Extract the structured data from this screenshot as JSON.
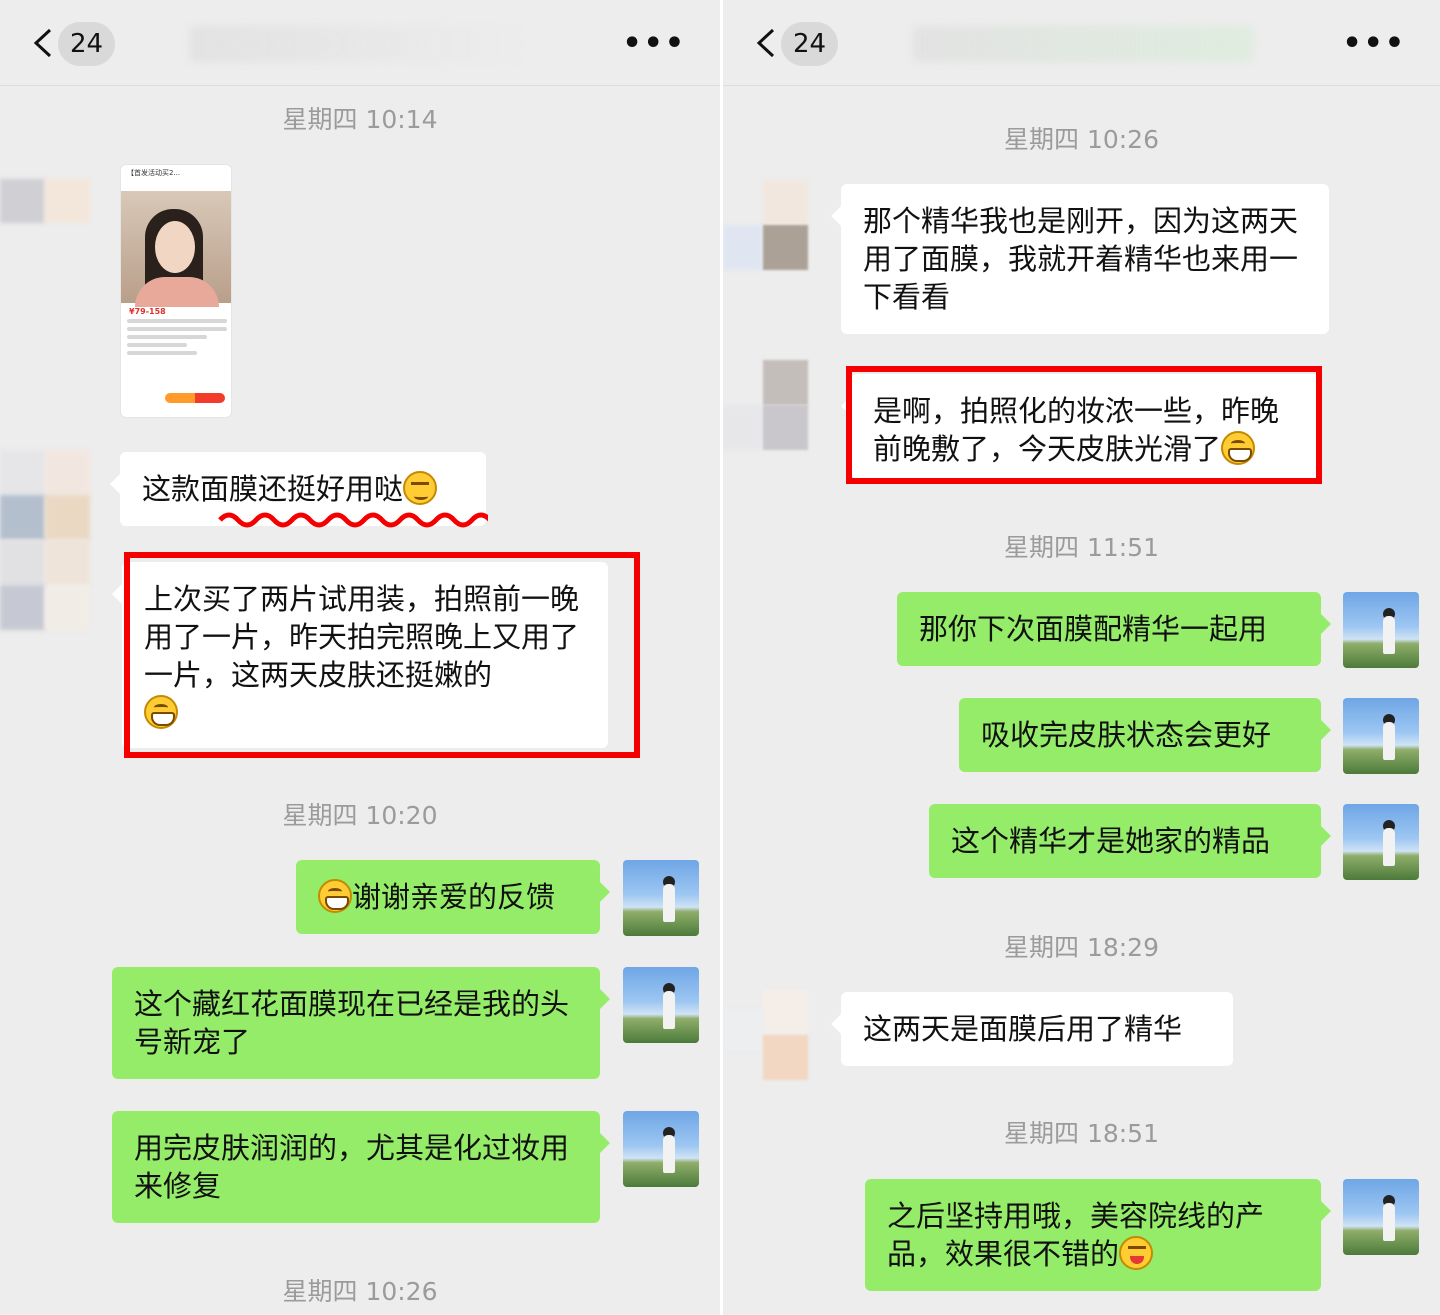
{
  "left": {
    "header": {
      "unread_badge": "24",
      "more": "•••"
    },
    "timestamps": [
      "星期四 10:14",
      "星期四 10:20",
      "星期四 10:26"
    ],
    "thumbnail": {
      "title": "【首发活动买2...",
      "price": "¥79-158"
    },
    "incoming": [
      "这款面膜还挺好用哒",
      "上次买了两片试用装，拍照前一晚用了一片，昨天拍完照晚上又用了一片，这两天皮肤还挺嫩的"
    ],
    "outgoing": [
      "谢谢亲爱的反馈",
      "这个藏红花面膜现在已经是我的头号新宠了",
      "用完皮肤润润的，尤其是化过妆用来修复"
    ]
  },
  "right": {
    "header": {
      "unread_badge": "24",
      "more": "•••"
    },
    "timestamps": [
      "星期四 10:26",
      "星期四 11:51",
      "星期四 18:29",
      "星期四 18:51"
    ],
    "incoming": [
      "那个精华我也是刚开，因为这两天用了面膜，我就开着精华也来用一下看看",
      "是啊，拍照化的妆浓一些，昨晚前晚敷了，今天皮肤光滑了",
      "这两天是面膜后用了精华"
    ],
    "outgoing": [
      "那你下次面膜配精华一起用",
      "吸收完皮肤状态会更好",
      "这个精华才是她家的精品",
      "之后坚持用哦，美容院线的产品，效果很不错的"
    ]
  },
  "colors": {
    "bg": "#ededed",
    "green_bubble": "#95ec69",
    "white_bubble": "#ffffff",
    "highlight_box": "#f50000",
    "timestamp": "#9b9b9b"
  },
  "icons": [
    "back-chevron-icon",
    "more-dots-icon",
    "grin-emoji-icon",
    "smirk-emoji-icon",
    "wink-emoji-icon"
  ]
}
